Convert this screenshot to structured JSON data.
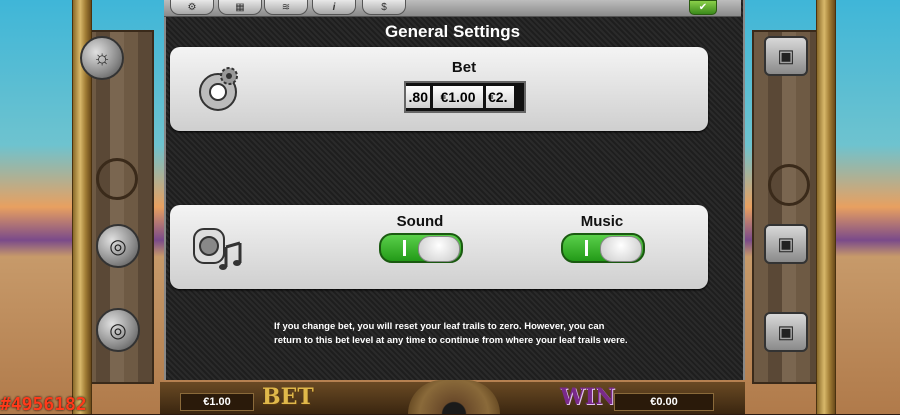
{
  "topbar": {
    "tabs": [
      {
        "icon": "gear-icon",
        "glyph": "⚙"
      },
      {
        "icon": "paytable-icon",
        "glyph": "▦"
      },
      {
        "icon": "paylines-icon",
        "glyph": "≋"
      },
      {
        "icon": "info-icon",
        "glyph": "i"
      },
      {
        "icon": "money-bag-icon",
        "glyph": "$"
      }
    ],
    "ok_glyph": "✔"
  },
  "dialog": {
    "title": "General Settings",
    "bet": {
      "label": "Bet",
      "prev_value": ".80",
      "current_value": "€1.00",
      "next_value": "€2."
    },
    "sound": {
      "label": "Sound",
      "on": true
    },
    "music": {
      "label": "Music",
      "on": true
    },
    "info_text": "If you change bet, you will reset your leaf trails to zero. However, you can return to this bet level at any time to continue from where your leaf trails were."
  },
  "footer": {
    "bet_value": "€1.00",
    "bet_word": "BET",
    "win_word": "WIN",
    "win_value": "€0.00",
    "score": "#4956182"
  },
  "colors": {
    "toggle_on": "#2fa520",
    "bet_word": "#e0b84a",
    "win_word": "#7a2a8a",
    "score": "#ff3a1a"
  }
}
